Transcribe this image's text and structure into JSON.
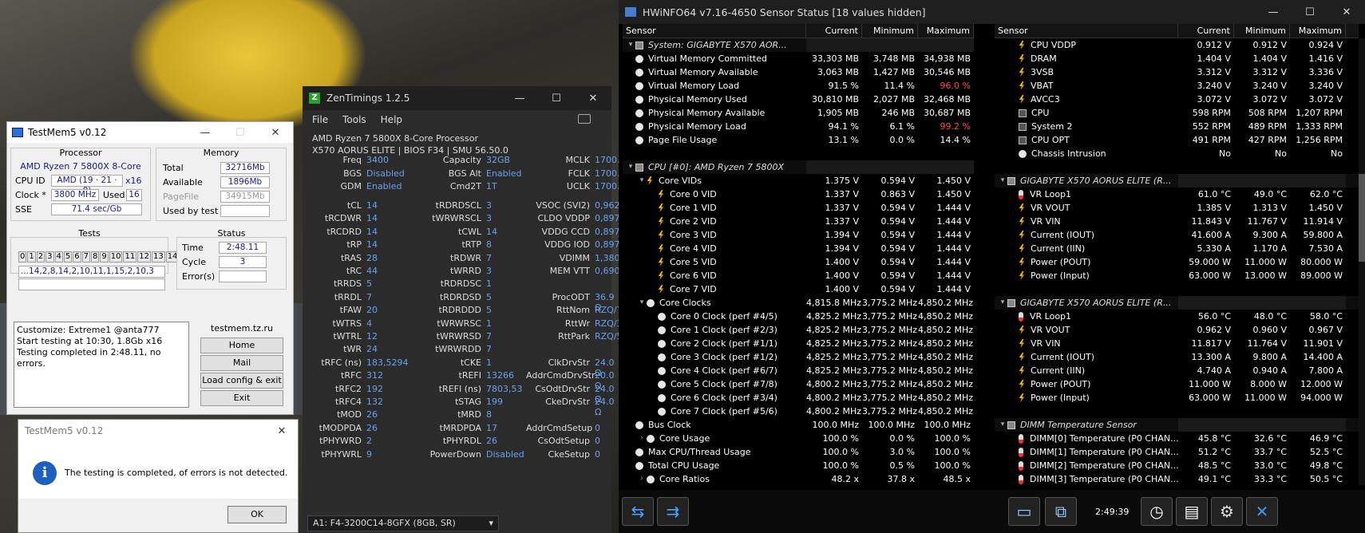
{
  "testmem": {
    "title": "TestMem5 v0.12",
    "processor_label": "Processor",
    "processor": "AMD Ryzen 7 5800X 8-Core",
    "cpuid_label": "CPU ID",
    "cpuid": "AMD  (19 · 21 · 0)",
    "threads": "x16",
    "clock_label": "Clock *",
    "clock": "3800 MHz",
    "used_label": "Used",
    "used": "16",
    "sse_label": "SSE",
    "sse": "71.4 sec/Gb",
    "memory_label": "Memory",
    "total_label": "Total",
    "total": "32716Mb",
    "available_label": "Available",
    "available": "1896Mb",
    "pagefile_label": "PageFile",
    "pagefile": "34915Mb",
    "usedbytest_label": "Used by test",
    "tests_label": "Tests",
    "test_cells": [
      "0",
      "1",
      "2",
      "3",
      "4",
      "5",
      "6",
      "7",
      "8",
      "9",
      "10",
      "11",
      "12",
      "13",
      "14",
      "15"
    ],
    "sequence": "...14,2,8,14,2,10,11,1,15,2,10,3",
    "status_label": "Status",
    "time_label": "Time",
    "time": "2:48.11",
    "cycle_label": "Cycle",
    "cycle": "3",
    "errors_label": "Error(s)",
    "log": [
      "Customize: Extreme1 @anta777",
      "Start testing at 10:30, 1.8Gb x16",
      "Testing completed in 2:48.11, no errors."
    ],
    "site": "testmem.tz.ru",
    "btn_home": "Home",
    "btn_mail": "Mail",
    "btn_load": "Load config & exit",
    "btn_exit": "Exit"
  },
  "dialog": {
    "title": "TestMem5 v0.12",
    "message": "The testing is completed, of errors is not detected.",
    "ok": "OK"
  },
  "zen": {
    "title": "ZenTimings 1.2.5",
    "menu": [
      "File",
      "Tools",
      "Help"
    ],
    "cpu": "AMD Ryzen 7 5800X 8-Core Processor",
    "board": "X570 AORUS ELITE | BIOS F34 | SMU 56.50.0",
    "rows1": [
      [
        "Freq",
        "3400",
        "Capacity",
        "32GB",
        "MCLK",
        "1700.00"
      ],
      [
        "BGS",
        "Disabled",
        "BGS Alt",
        "Enabled",
        "FCLK",
        "1700.00"
      ],
      [
        "GDM",
        "Enabled",
        "Cmd2T",
        "1T",
        "UCLK",
        "1700.00"
      ]
    ],
    "rows2": [
      [
        "tCL",
        "14",
        "tRDRDSCL",
        "3",
        "VSOC (SVI2)",
        "0,9625V"
      ],
      [
        "tRCDWR",
        "14",
        "tWRWRSCL",
        "3",
        "CLDO VDDP",
        "0,8973V"
      ],
      [
        "tRCDRD",
        "14",
        "tCWL",
        "14",
        "VDDG CCD",
        "0,8973V"
      ],
      [
        "tRP",
        "14",
        "tRTP",
        "8",
        "VDDG IOD",
        "0,8973V"
      ],
      [
        "tRAS",
        "28",
        "tRDWR",
        "7",
        "VDIMM",
        "1,3800V"
      ],
      [
        "tRC",
        "44",
        "tWRRD",
        "3",
        "MEM VTT",
        "0,6900V"
      ],
      [
        "tRRDS",
        "5",
        "tRDRDSC",
        "1",
        "",
        ""
      ],
      [
        "tRRDL",
        "7",
        "tRDRDSD",
        "5",
        "ProcODT",
        "36.9 Ω"
      ],
      [
        "tFAW",
        "20",
        "tRDRDDD",
        "5",
        "RttNom",
        "RZQ/7"
      ],
      [
        "tWTRS",
        "4",
        "tWRWRSC",
        "1",
        "RttWr",
        "RZQ/3"
      ],
      [
        "tWTRL",
        "12",
        "tWRWRSD",
        "7",
        "RttPark",
        "RZQ/5"
      ],
      [
        "tWR",
        "24",
        "tWRWRDD",
        "7",
        "",
        ""
      ],
      [
        "tRFC (ns)",
        "183,5294",
        "tCKE",
        "1",
        "ClkDrvStr",
        "24.0 Ω"
      ],
      [
        "tRFC",
        "312",
        "tREFI",
        "13266",
        "AddrCmdDrvStr",
        "20.0 Ω"
      ],
      [
        "tRFC2",
        "192",
        "tREFI (ns)",
        "7803,53",
        "CsOdtDrvStr",
        "24.0 Ω"
      ],
      [
        "tRFC4",
        "132",
        "tSTAG",
        "199",
        "CkeDrvStr",
        "24.0 Ω"
      ],
      [
        "tMOD",
        "26",
        "tMRD",
        "8",
        "",
        ""
      ],
      [
        "tMODPDA",
        "26",
        "tMRDPDA",
        "17",
        "AddrCmdSetup",
        "0"
      ],
      [
        "tPHYWRD",
        "2",
        "tPHYRDL",
        "26",
        "CsOdtSetup",
        "0"
      ],
      [
        "tPHYWRL",
        "9",
        "PowerDown",
        "Disabled",
        "CkeSetup",
        "0"
      ]
    ],
    "module": "A1: F4-3200C14-8GFX (8GB, SR)"
  },
  "hwinfo": {
    "title": "HWiNFO64 v7.16-4650 Sensor Status [18 values hidden]",
    "headers": [
      "Sensor",
      "Current",
      "Minimum",
      "Maximum"
    ],
    "left": [
      {
        "g": 1,
        "t": "▾",
        "i": "chip",
        "n": "System: GIGABYTE X570 AOR...",
        "c": "",
        "mi": "",
        "ma": ""
      },
      {
        "i": "circ",
        "n": "Virtual Memory Committed",
        "c": "33,303 MB",
        "mi": "3,748 MB",
        "ma": "34,938 MB"
      },
      {
        "i": "circ",
        "n": "Virtual Memory Available",
        "c": "3,063 MB",
        "mi": "1,427 MB",
        "ma": "30,546 MB"
      },
      {
        "i": "circ",
        "n": "Virtual Memory Load",
        "c": "91.5 %",
        "mi": "11.4 %",
        "ma": "96.0 %",
        "r": 1
      },
      {
        "i": "circ",
        "n": "Physical Memory Used",
        "c": "30,810 MB",
        "mi": "2,027 MB",
        "ma": "32,468 MB"
      },
      {
        "i": "circ",
        "n": "Physical Memory Available",
        "c": "1,905 MB",
        "mi": "246 MB",
        "ma": "30,687 MB"
      },
      {
        "i": "circ",
        "n": "Physical Memory Load",
        "c": "94.1 %",
        "mi": "6.1 %",
        "ma": "99.2 %",
        "r": 1
      },
      {
        "i": "circ",
        "n": "Page File Usage",
        "c": "13.1 %",
        "mi": "0.0 %",
        "ma": "14.4 %"
      },
      {
        "blank": 1
      },
      {
        "g": 1,
        "t": "▾",
        "i": "chip",
        "n": "CPU [#0]: AMD Ryzen 7 5800X",
        "c": "",
        "mi": "",
        "ma": ""
      },
      {
        "d": 1,
        "t": "▾",
        "i": "bolt",
        "n": "Core VIDs",
        "c": "1.375 V",
        "mi": "0.594 V",
        "ma": "1.450 V"
      },
      {
        "d": 2,
        "i": "bolt",
        "n": "Core 0 VID",
        "c": "1.337 V",
        "mi": "0.863 V",
        "ma": "1.450 V"
      },
      {
        "d": 2,
        "i": "bolt",
        "n": "Core 1 VID",
        "c": "1.337 V",
        "mi": "0.594 V",
        "ma": "1.444 V"
      },
      {
        "d": 2,
        "i": "bolt",
        "n": "Core 2 VID",
        "c": "1.337 V",
        "mi": "0.594 V",
        "ma": "1.444 V"
      },
      {
        "d": 2,
        "i": "bolt",
        "n": "Core 3 VID",
        "c": "1.394 V",
        "mi": "0.594 V",
        "ma": "1.444 V"
      },
      {
        "d": 2,
        "i": "bolt",
        "n": "Core 4 VID",
        "c": "1.394 V",
        "mi": "0.594 V",
        "ma": "1.444 V"
      },
      {
        "d": 2,
        "i": "bolt",
        "n": "Core 5 VID",
        "c": "1.400 V",
        "mi": "0.594 V",
        "ma": "1.444 V"
      },
      {
        "d": 2,
        "i": "bolt",
        "n": "Core 6 VID",
        "c": "1.400 V",
        "mi": "0.594 V",
        "ma": "1.444 V"
      },
      {
        "d": 2,
        "i": "bolt",
        "n": "Core 7 VID",
        "c": "1.400 V",
        "mi": "0.594 V",
        "ma": "1.444 V"
      },
      {
        "d": 1,
        "t": "▾",
        "i": "circ",
        "n": "Core Clocks",
        "c": "4,815.8 MHz",
        "mi": "3,775.2 MHz",
        "ma": "4,850.2 MHz"
      },
      {
        "d": 2,
        "i": "circ",
        "n": "Core 0 Clock (perf #4/5)",
        "c": "4,825.2 MHz",
        "mi": "3,775.2 MHz",
        "ma": "4,850.2 MHz"
      },
      {
        "d": 2,
        "i": "circ",
        "n": "Core 1 Clock (perf #2/3)",
        "c": "4,825.2 MHz",
        "mi": "3,775.2 MHz",
        "ma": "4,850.2 MHz"
      },
      {
        "d": 2,
        "i": "circ",
        "n": "Core 2 Clock (perf #1/1)",
        "c": "4,825.2 MHz",
        "mi": "3,775.2 MHz",
        "ma": "4,850.2 MHz"
      },
      {
        "d": 2,
        "i": "circ",
        "n": "Core 3 Clock (perf #1/2)",
        "c": "4,825.2 MHz",
        "mi": "3,775.2 MHz",
        "ma": "4,850.2 MHz"
      },
      {
        "d": 2,
        "i": "circ",
        "n": "Core 4 Clock (perf #6/7)",
        "c": "4,825.2 MHz",
        "mi": "3,775.2 MHz",
        "ma": "4,850.2 MHz"
      },
      {
        "d": 2,
        "i": "circ",
        "n": "Core 5 Clock (perf #7/8)",
        "c": "4,800.2 MHz",
        "mi": "3,775.2 MHz",
        "ma": "4,850.2 MHz"
      },
      {
        "d": 2,
        "i": "circ",
        "n": "Core 6 Clock (perf #3/4)",
        "c": "4,800.2 MHz",
        "mi": "3,775.2 MHz",
        "ma": "4,850.2 MHz"
      },
      {
        "d": 2,
        "i": "circ",
        "n": "Core 7 Clock (perf #5/6)",
        "c": "4,800.2 MHz",
        "mi": "3,775.2 MHz",
        "ma": "4,850.2 MHz"
      },
      {
        "i": "circ",
        "n": "Bus Clock",
        "c": "100.0 MHz",
        "mi": "100.0 MHz",
        "ma": "100.0 MHz"
      },
      {
        "d": 1,
        "t": "›",
        "i": "circ",
        "n": "Core Usage",
        "c": "100.0 %",
        "mi": "0.0 %",
        "ma": "100.0 %"
      },
      {
        "i": "circ",
        "n": "Max CPU/Thread Usage",
        "c": "100.0 %",
        "mi": "3.0 %",
        "ma": "100.0 %"
      },
      {
        "i": "circ",
        "n": "Total CPU Usage",
        "c": "100.0 %",
        "mi": "0.5 %",
        "ma": "100.0 %"
      },
      {
        "d": 1,
        "t": "›",
        "i": "circ",
        "n": "Core Ratios",
        "c": "48.2 x",
        "mi": "37.8 x",
        "ma": "48.5 x"
      }
    ],
    "right": [
      {
        "d": 1,
        "i": "bolt",
        "n": "CPU VDDP",
        "c": "0.912 V",
        "mi": "0.912 V",
        "ma": "0.924 V"
      },
      {
        "d": 1,
        "i": "bolt",
        "n": "DRAM",
        "c": "1.404 V",
        "mi": "1.404 V",
        "ma": "1.416 V"
      },
      {
        "d": 1,
        "i": "bolt",
        "n": "3VSB",
        "c": "3.312 V",
        "mi": "3.312 V",
        "ma": "3.336 V"
      },
      {
        "d": 1,
        "i": "bolt",
        "n": "VBAT",
        "c": "3.240 V",
        "mi": "3.240 V",
        "ma": "3.240 V"
      },
      {
        "d": 1,
        "i": "bolt",
        "n": "AVCC3",
        "c": "3.072 V",
        "mi": "3.072 V",
        "ma": "3.072 V"
      },
      {
        "d": 1,
        "i": "fan",
        "n": "CPU",
        "c": "598 RPM",
        "mi": "508 RPM",
        "ma": "1,207 RPM"
      },
      {
        "d": 1,
        "i": "fan",
        "n": "System 2",
        "c": "552 RPM",
        "mi": "489 RPM",
        "ma": "1,333 RPM"
      },
      {
        "d": 1,
        "i": "fan",
        "n": "CPU OPT",
        "c": "491 RPM",
        "mi": "427 RPM",
        "ma": "1,256 RPM"
      },
      {
        "d": 1,
        "i": "circ",
        "n": "Chassis Intrusion",
        "c": "No",
        "mi": "No",
        "ma": "No"
      },
      {
        "blank": 1
      },
      {
        "g": 1,
        "t": "▾",
        "i": "chip",
        "n": "GIGABYTE X570 AORUS ELITE (R...",
        "c": "",
        "mi": "",
        "ma": ""
      },
      {
        "d": 1,
        "i": "therm",
        "n": "VR Loop1",
        "c": "61.0 °C",
        "mi": "49.0 °C",
        "ma": "62.0 °C"
      },
      {
        "d": 1,
        "i": "bolt",
        "n": "VR VOUT",
        "c": "1.385 V",
        "mi": "1.313 V",
        "ma": "1.450 V"
      },
      {
        "d": 1,
        "i": "bolt",
        "n": "VR VIN",
        "c": "11.843 V",
        "mi": "11.767 V",
        "ma": "11.914 V"
      },
      {
        "d": 1,
        "i": "bolt",
        "n": "Current (IOUT)",
        "c": "41.600 A",
        "mi": "9.300 A",
        "ma": "59.800 A"
      },
      {
        "d": 1,
        "i": "bolt",
        "n": "Current (IIN)",
        "c": "5.330 A",
        "mi": "1.170 A",
        "ma": "7.530 A"
      },
      {
        "d": 1,
        "i": "bolt",
        "n": "Power (POUT)",
        "c": "59.000 W",
        "mi": "11.000 W",
        "ma": "80.000 W"
      },
      {
        "d": 1,
        "i": "bolt",
        "n": "Power (Input)",
        "c": "63.000 W",
        "mi": "13.000 W",
        "ma": "89.000 W"
      },
      {
        "blank": 1
      },
      {
        "g": 1,
        "t": "▾",
        "i": "chip",
        "n": "GIGABYTE X570 AORUS ELITE (R...",
        "c": "",
        "mi": "",
        "ma": ""
      },
      {
        "d": 1,
        "i": "therm",
        "n": "VR Loop1",
        "c": "56.0 °C",
        "mi": "48.0 °C",
        "ma": "58.0 °C"
      },
      {
        "d": 1,
        "i": "bolt",
        "n": "VR VOUT",
        "c": "0.962 V",
        "mi": "0.960 V",
        "ma": "0.967 V"
      },
      {
        "d": 1,
        "i": "bolt",
        "n": "VR VIN",
        "c": "11.817 V",
        "mi": "11.764 V",
        "ma": "11.901 V"
      },
      {
        "d": 1,
        "i": "bolt",
        "n": "Current (IOUT)",
        "c": "13.300 A",
        "mi": "9.800 A",
        "ma": "14.400 A"
      },
      {
        "d": 1,
        "i": "bolt",
        "n": "Current (IIN)",
        "c": "4.740 A",
        "mi": "0.940 A",
        "ma": "7.800 A"
      },
      {
        "d": 1,
        "i": "bolt",
        "n": "Power (POUT)",
        "c": "11.000 W",
        "mi": "8.000 W",
        "ma": "12.000 W"
      },
      {
        "d": 1,
        "i": "bolt",
        "n": "Power (Input)",
        "c": "63.000 W",
        "mi": "11.000 W",
        "ma": "94.000 W"
      },
      {
        "blank": 1
      },
      {
        "g": 1,
        "t": "▾",
        "i": "chip",
        "n": "DIMM Temperature Sensor",
        "c": "",
        "mi": "",
        "ma": ""
      },
      {
        "d": 1,
        "i": "therm",
        "n": "DIMM[0] Temperature (P0 CHAN...",
        "c": "45.8 °C",
        "mi": "32.6 °C",
        "ma": "46.9 °C"
      },
      {
        "d": 1,
        "i": "therm",
        "n": "DIMM[1] Temperature (P0 CHAN...",
        "c": "51.2 °C",
        "mi": "33.7 °C",
        "ma": "52.5 °C"
      },
      {
        "d": 1,
        "i": "therm",
        "n": "DIMM[2] Temperature (P0 CHAN...",
        "c": "48.5 °C",
        "mi": "33.0 °C",
        "ma": "49.8 °C"
      },
      {
        "d": 1,
        "i": "therm",
        "n": "DIMM[3] Temperature (P0 CHAN...",
        "c": "49.1 °C",
        "mi": "33.3 °C",
        "ma": "50.5 °C"
      }
    ],
    "time": "2:49:39"
  }
}
